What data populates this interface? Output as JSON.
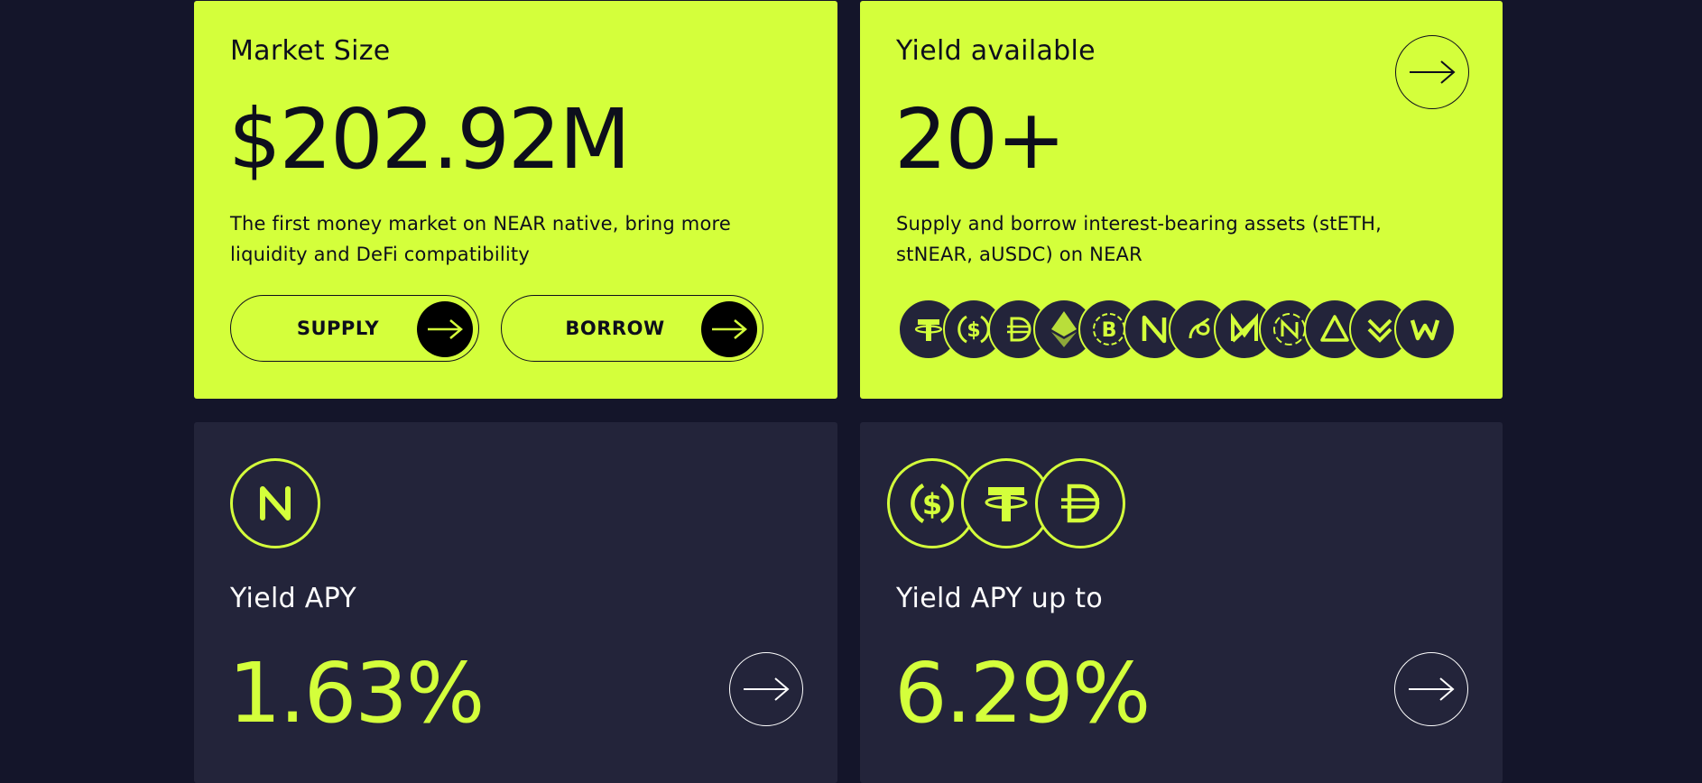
{
  "market_card": {
    "title": "Market Size",
    "value": "$202.92M",
    "description": "The first money market on NEAR native, bring more liquidity and DeFi compatibility",
    "supply_label": "SUPPLY",
    "borrow_label": "BORROW"
  },
  "yield_card": {
    "title": "Yield available",
    "value": "20+",
    "description": "Supply and borrow interest-bearing assets (stETH, stNEAR, aUSDC) on NEAR",
    "tokens": [
      "usdt-icon",
      "usdc-icon",
      "dai-icon",
      "eth-icon",
      "btc-icon",
      "near-icon",
      "aurora-icon",
      "stnear-icon",
      "linear-icon",
      "aurora-triangle-icon",
      "woo-down-icon",
      "woo-icon"
    ]
  },
  "apy_near_card": {
    "label": "Yield APY",
    "value": "1.63%",
    "logo": "near-icon"
  },
  "apy_stable_card": {
    "label": "Yield APY up to",
    "value": "6.29%",
    "logos": [
      "usdc-icon",
      "usdt-icon",
      "dai-icon"
    ]
  },
  "colors": {
    "background": "#14152a",
    "accent": "#d4ff3b",
    "card_dark": "#23243a",
    "ink": "#0d0e1c"
  }
}
